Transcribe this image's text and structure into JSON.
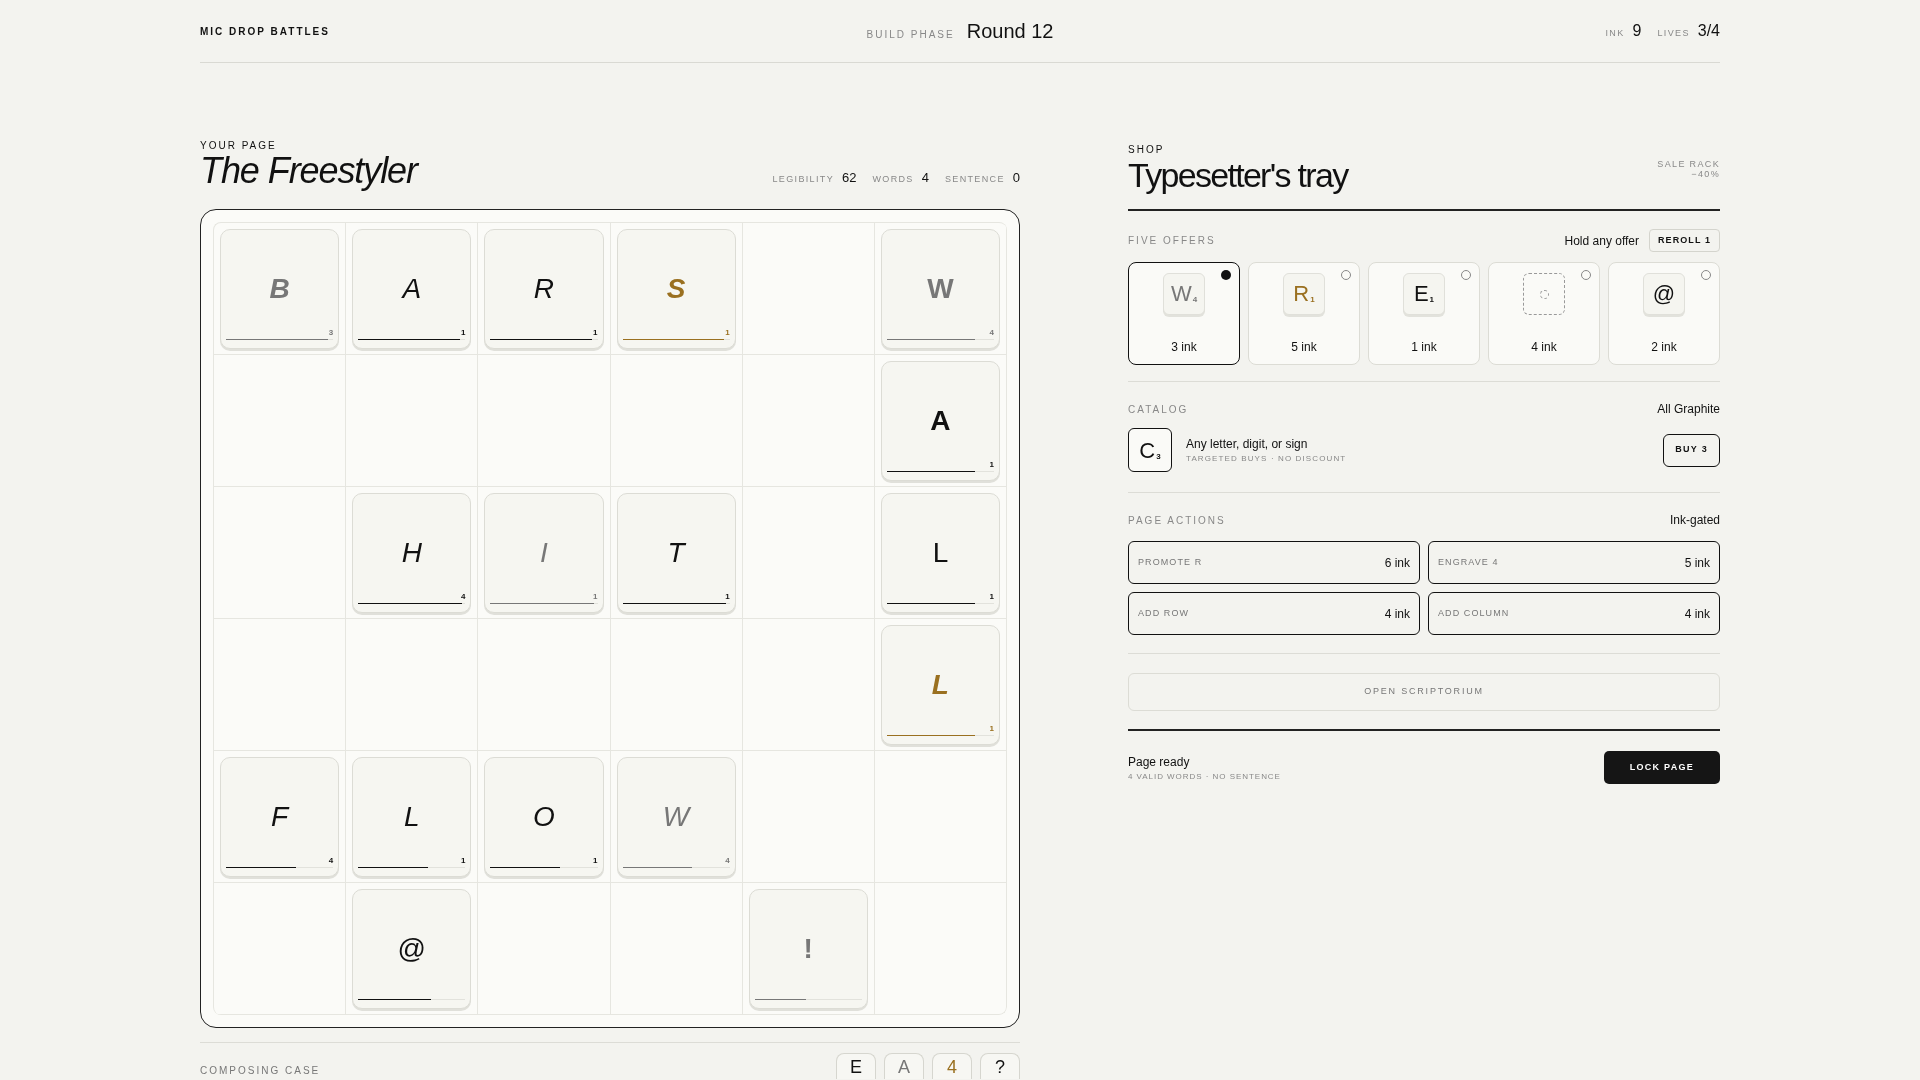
{
  "header": {
    "brand": "MIC DROP BATTLES",
    "phase_label": "BUILD PHASE",
    "round": "Round 12",
    "stats": [
      {
        "label": "INK",
        "value": "9"
      },
      {
        "label": "LIVES",
        "value": "3/4"
      }
    ]
  },
  "page": {
    "eyebrow": "YOUR PAGE",
    "title": "The Freestyler",
    "stats": [
      {
        "label": "LEGIBILITY",
        "value": "62"
      },
      {
        "label": "WORDS",
        "value": "4"
      },
      {
        "label": "SENTENCE",
        "value": "0"
      }
    ],
    "board": [
      [
        {
          "kind": "tile",
          "letter": "B",
          "points": "3",
          "color": "#777777",
          "bold": true,
          "italic": true,
          "level": 0.95
        },
        {
          "kind": "tile",
          "letter": "A",
          "points": "1",
          "color": "#111111",
          "bold": false,
          "italic": true,
          "level": 0.95
        },
        {
          "kind": "tile",
          "letter": "R",
          "points": "1",
          "color": "#111111",
          "bold": false,
          "italic": true,
          "level": 0.95
        },
        {
          "kind": "tile",
          "letter": "S",
          "points": "1",
          "color": "#9a7020",
          "bold": true,
          "italic": true,
          "level": 0.95
        },
        {
          "kind": "empty"
        },
        {
          "kind": "tile",
          "letter": "W",
          "points": "4",
          "color": "#777777",
          "bold": true,
          "italic": false,
          "level": 0.82
        }
      ],
      [
        {
          "kind": "empty"
        },
        {
          "kind": "empty"
        },
        {
          "kind": "empty"
        },
        {
          "kind": "empty"
        },
        {
          "kind": "empty"
        },
        {
          "kind": "tile",
          "letter": "A",
          "points": "1",
          "color": "#111111",
          "bold": true,
          "italic": false,
          "level": 0.82
        }
      ],
      [
        {
          "kind": "empty"
        },
        {
          "kind": "tile",
          "letter": "H",
          "points": "4",
          "color": "#111111",
          "bold": false,
          "italic": true,
          "level": 0.97
        },
        {
          "kind": "tile",
          "letter": "I",
          "points": "1",
          "color": "#777777",
          "bold": false,
          "italic": true,
          "level": 0.97
        },
        {
          "kind": "tile",
          "letter": "T",
          "points": "1",
          "color": "#111111",
          "bold": false,
          "italic": true,
          "level": 0.97
        },
        {
          "kind": "empty"
        },
        {
          "kind": "tile",
          "letter": "L",
          "points": "1",
          "color": "#111111",
          "bold": false,
          "italic": false,
          "level": 0.82
        }
      ],
      [
        {
          "kind": "empty"
        },
        {
          "kind": "empty"
        },
        {
          "kind": "empty"
        },
        {
          "kind": "empty"
        },
        {
          "kind": "empty"
        },
        {
          "kind": "tile",
          "letter": "L",
          "points": "1",
          "color": "#9a7020",
          "bold": true,
          "italic": true,
          "level": 0.82
        }
      ],
      [
        {
          "kind": "tile",
          "letter": "F",
          "points": "4",
          "color": "#111111",
          "bold": false,
          "italic": true,
          "level": 0.65
        },
        {
          "kind": "tile",
          "letter": "L",
          "points": "1",
          "color": "#111111",
          "bold": false,
          "italic": true,
          "level": 0.65
        },
        {
          "kind": "tile",
          "letter": "O",
          "points": "1",
          "color": "#111111",
          "bold": false,
          "italic": true,
          "level": 0.65
        },
        {
          "kind": "tile",
          "letter": "W",
          "points": "4",
          "color": "#777777",
          "bold": false,
          "italic": true,
          "level": 0.65
        },
        {
          "kind": "empty"
        },
        {
          "kind": "empty"
        }
      ],
      [
        {
          "kind": "empty"
        },
        {
          "kind": "tile",
          "letter": "@",
          "color": "#111111",
          "bold": false,
          "italic": false,
          "level": 0.68
        },
        {
          "kind": "empty"
        },
        {
          "kind": "empty"
        },
        {
          "kind": "tile",
          "letter": "!",
          "color": "#777777",
          "bold": true,
          "italic": false,
          "level": 0.48
        },
        {
          "kind": "empty"
        }
      ]
    ],
    "case_label": "COMPOSING CASE",
    "case_tiles": [
      {
        "letter": "E",
        "color": "#111111"
      },
      {
        "letter": "A",
        "color": "#777777"
      },
      {
        "letter": "4",
        "color": "#9a7020"
      },
      {
        "letter": "?",
        "color": "#111111"
      }
    ]
  },
  "shop": {
    "eyebrow": "SHOP",
    "title": "Typesetter's tray",
    "sale": [
      "SALE RACK",
      "−40%"
    ],
    "offers_label": "FIVE OFFERS",
    "offers_hint": "Hold any offer",
    "reroll": "REROLL 1",
    "offers": [
      {
        "kind": "letter",
        "letter": "W",
        "points": "4",
        "color": "#777777",
        "price": "3 ink",
        "selected": true
      },
      {
        "kind": "letter",
        "letter": "R",
        "points": "1",
        "color": "#9a7020",
        "price": "5 ink",
        "selected": false
      },
      {
        "kind": "letter",
        "letter": "E",
        "points": "1",
        "color": "#111111",
        "price": "1 ink",
        "selected": false
      },
      {
        "kind": "blank",
        "price": "4 ink",
        "selected": false
      },
      {
        "kind": "letter",
        "letter": "@",
        "color": "#111111",
        "price": "2 ink",
        "selected": false
      }
    ],
    "catalog_label": "CATALOG",
    "catalog_hint": "All Graphite",
    "catalog_item": {
      "letter": "C",
      "points": "3",
      "title": "Any letter, digit, or sign",
      "note": "TARGETED BUYS · NO DISCOUNT",
      "button": "BUY 3"
    },
    "actions_label": "PAGE ACTIONS",
    "actions_hint": "Ink-gated",
    "actions": [
      {
        "label": "PROMOTE R",
        "cost": "6 ink"
      },
      {
        "label": "ENGRAVE 4",
        "cost": "5 ink"
      },
      {
        "label": "ADD ROW",
        "cost": "4 ink"
      },
      {
        "label": "ADD COLUMN",
        "cost": "4 ink"
      }
    ],
    "scriptorium": "OPEN SCRIPTORIUM",
    "status": "Page ready",
    "status_note": "4 VALID WORDS · NO SENTENCE",
    "lock": "LOCK PAGE"
  }
}
